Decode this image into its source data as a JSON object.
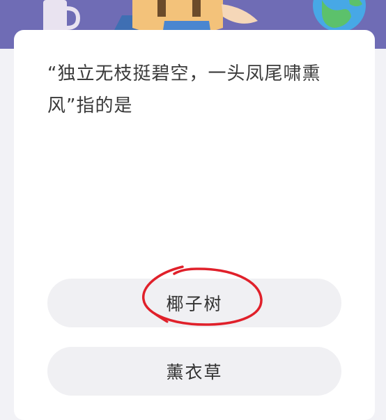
{
  "question": {
    "text": "“独立无枝挺碧空，一头凤尾啸熏风”指的是"
  },
  "options": [
    {
      "label": "椰子树"
    },
    {
      "label": "薰衣草"
    }
  ],
  "colors": {
    "banner": "#6f6cb5",
    "card": "#ffffff",
    "option_bg": "#f0f0f3",
    "annotation_circle": "#e0202a"
  },
  "annotation": {
    "type": "hand-drawn circle around first option"
  }
}
